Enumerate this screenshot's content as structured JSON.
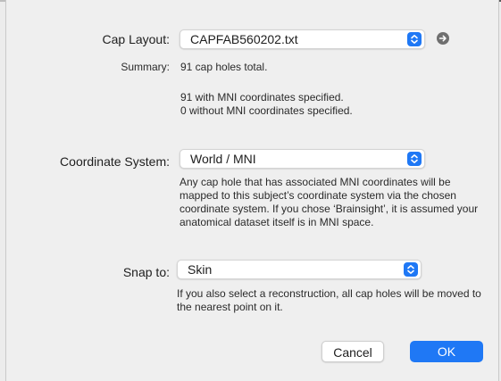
{
  "cap_layout": {
    "label": "Cap Layout:",
    "value": "CAPFAB560202.txt",
    "action_icon": "arrow-right-circle-icon"
  },
  "summary": {
    "label": "Summary:",
    "total": "91 cap holes total.",
    "with_mni": "91 with MNI coordinates specified.",
    "without_mni": "0 without MNI coordinates specified."
  },
  "coordinate_system": {
    "label": "Coordinate System:",
    "value": "World / MNI",
    "help": "Any cap hole that has associated MNI coordinates will be mapped to this subject’s coordinate system via the chosen coordinate system. If you chose ‘Brainsight’, it is assumed your anatomical dataset itself is in MNI space."
  },
  "snap_to": {
    "label": "Snap to:",
    "value": "Skin",
    "help": "If you also select a reconstruction, all cap holes will be moved to the nearest point on it."
  },
  "buttons": {
    "cancel": "Cancel",
    "ok": "OK"
  },
  "colors": {
    "accent": "#1f78f5",
    "background": "#efefef"
  }
}
